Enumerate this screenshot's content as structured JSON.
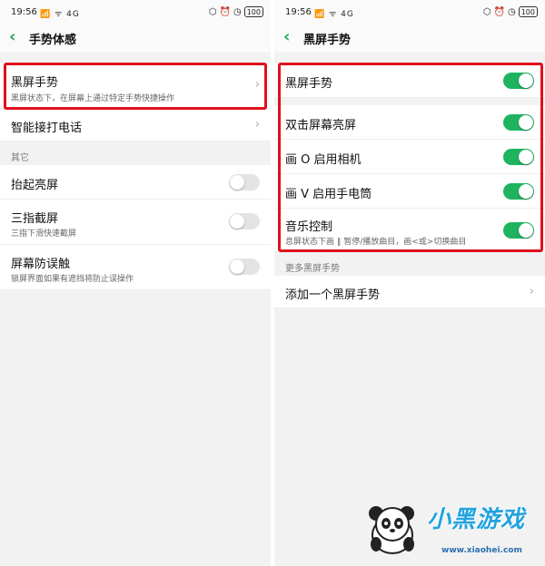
{
  "left_screen": {
    "status": {
      "time": "19:56",
      "signals": "📶 ᯤ 4G",
      "battery": "100"
    },
    "header": {
      "title": "手势体感"
    },
    "rows": [
      {
        "label": "黑屏手势",
        "sub": "黑屏状态下，在屏幕上通过特定手势快捷操作"
      },
      {
        "label": "智能接打电话"
      }
    ],
    "section_label": "其它",
    "toggle_rows": [
      {
        "label": "抬起亮屏",
        "sub": "",
        "on": false
      },
      {
        "label": "三指截屏",
        "sub": "三指下滑快速截屏",
        "on": false
      },
      {
        "label": "屏幕防误触",
        "sub": "锁屏界面如果有遮挡将防止误操作",
        "on": false
      }
    ]
  },
  "right_screen": {
    "status": {
      "time": "19:56",
      "signals": "📶 ᯤ 4G",
      "battery": "100"
    },
    "header": {
      "title": "黑屏手势"
    },
    "master": {
      "label": "黑屏手势",
      "on": true
    },
    "gestures": [
      {
        "label": "双击屏幕亮屏",
        "sub": "",
        "on": true
      },
      {
        "label": "画 O 启用相机",
        "sub": "",
        "on": true
      },
      {
        "label": "画 V 启用手电筒",
        "sub": "",
        "on": true
      },
      {
        "label": "音乐控制",
        "sub": "息屏状态下画 ‖ 暂停/播放曲目，画<或>切换曲目",
        "on": true
      }
    ],
    "section_label": "更多黑屏手势",
    "add_row": {
      "label": "添加一个黑屏手势"
    }
  },
  "watermark": {
    "text": "小黑游戏",
    "url": "www.xiaohei.com"
  },
  "colors": {
    "accent": "#1fb360",
    "highlight": "#e0101c",
    "background": "#f2f2f2"
  }
}
